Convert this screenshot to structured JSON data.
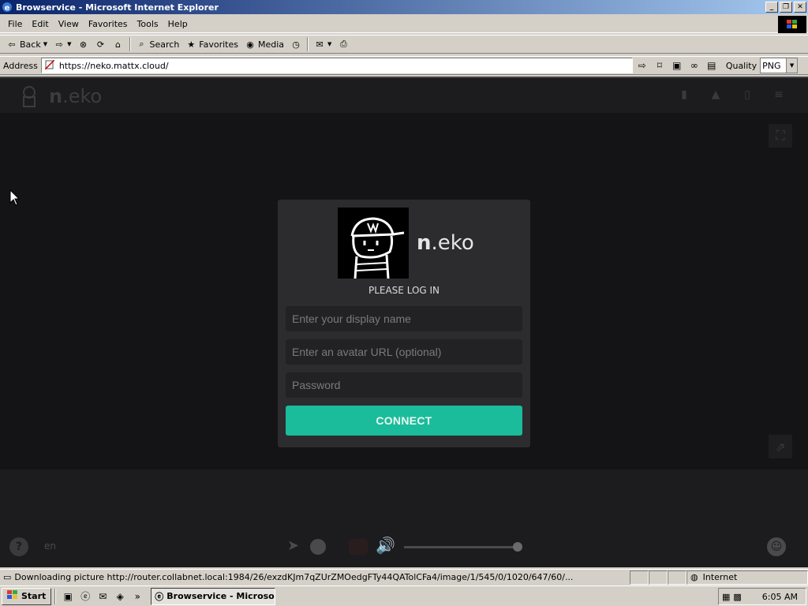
{
  "window": {
    "title": "Browservice - Microsoft Internet Explorer",
    "min": "_",
    "max": "❐",
    "close": "✕"
  },
  "menu": [
    "File",
    "Edit",
    "View",
    "Favorites",
    "Tools",
    "Help"
  ],
  "toolbar": {
    "back": "Back",
    "search": "Search",
    "favorites": "Favorites",
    "media": "Media"
  },
  "address": {
    "label": "Address",
    "url": "https://neko.mattx.cloud/",
    "quality_label": "Quality",
    "quality_value": "PNG"
  },
  "app": {
    "brand_bold": "n",
    "brand_rest": ".eko",
    "login": {
      "title": "PLEASE LOG IN",
      "display_name_placeholder": "Enter your display name",
      "avatar_placeholder": "Enter an avatar URL (optional)",
      "password_placeholder": "Password",
      "connect_label": "CONNECT"
    },
    "controls": {
      "help": "?",
      "lang": "en",
      "volume": 1.0
    }
  },
  "status": {
    "text": "Downloading picture http://router.collabnet.local:1984/26/exzdKJm7qZUrZMOedgFTy44QATolCFa4/image/1/545/0/1020/647/60/...",
    "zone": "Internet"
  },
  "taskbar": {
    "start": "Start",
    "task": "Browservice - Microso...",
    "clock": "6:05 AM"
  },
  "colors": {
    "accent": "#1bbc9b",
    "titlebar": "#0a246a"
  }
}
